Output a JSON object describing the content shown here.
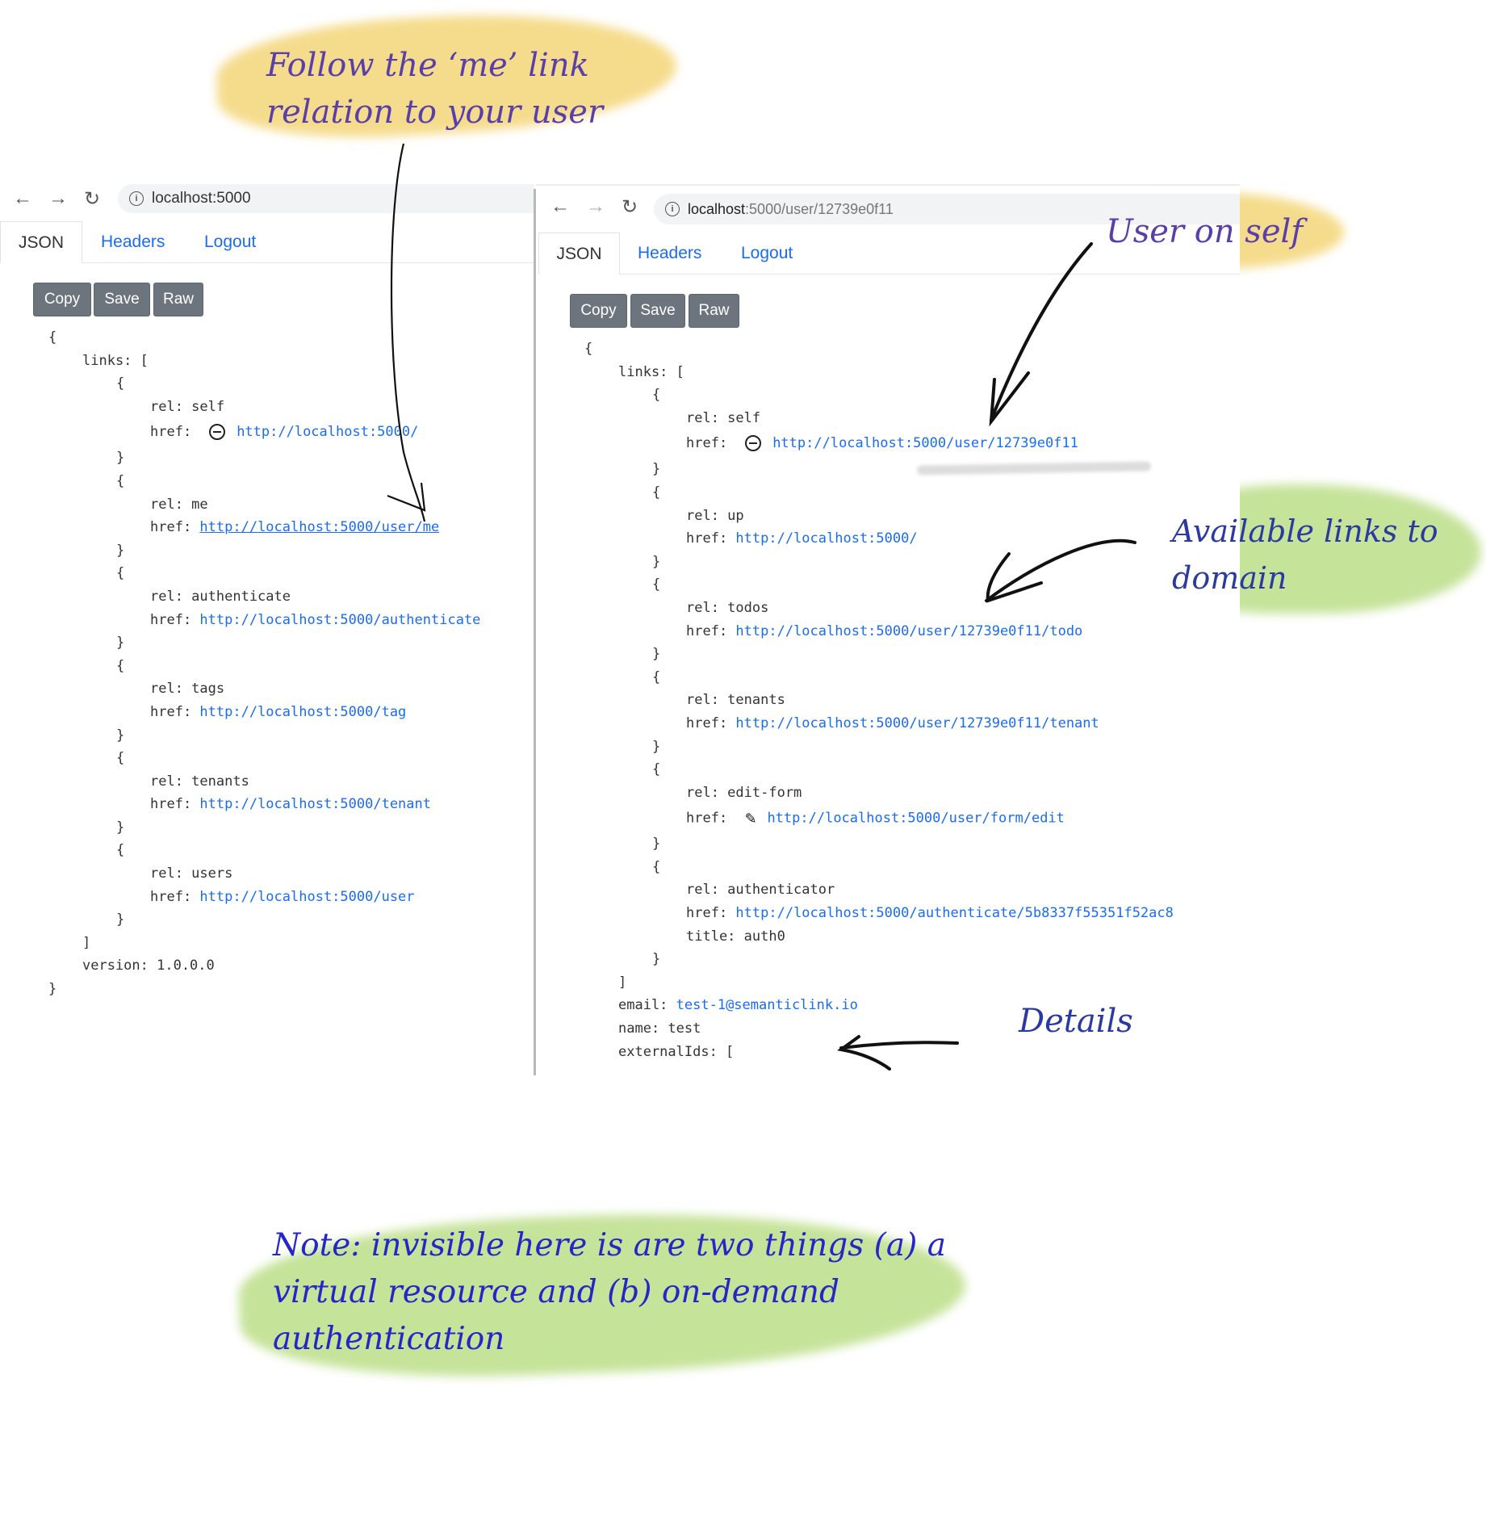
{
  "colors": {
    "link": "#1a6cf0",
    "button": "#6c757d",
    "annotation_purple": "#5b3fa8",
    "annotation_blue": "#2626c8",
    "highlight_yellow": "#f5dc8c",
    "highlight_green": "#c6e39a"
  },
  "annotations": {
    "follow_me": [
      "Follow the ‘me’ link",
      "relation to your user"
    ],
    "user_on_self": "User on self",
    "available_links": [
      "Available links to",
      "domain"
    ],
    "details": "Details",
    "note": [
      "Note: invisible here is are two things (a) a",
      "virtual resource and (b) on-demand",
      "authentication"
    ]
  },
  "left": {
    "url": "localhost:5000",
    "tabs": [
      "JSON",
      "Headers",
      "Logout"
    ],
    "buttons": [
      "Copy",
      "Save",
      "Raw"
    ],
    "code_lines": [
      {
        "indent": 0,
        "text": "{"
      },
      {
        "indent": 1,
        "text": "links: ["
      },
      {
        "indent": 2,
        "text": "{"
      },
      {
        "indent": 3,
        "text": "rel: self"
      },
      {
        "indent": 3,
        "text": "href:",
        "icon": "minus-circle-icon",
        "link": "http://localhost:5000/"
      },
      {
        "indent": 2,
        "text": "}"
      },
      {
        "indent": 2,
        "text": "{"
      },
      {
        "indent": 3,
        "text": "rel: me"
      },
      {
        "indent": 3,
        "text": "href: ",
        "link": "http://localhost:5000/user/me",
        "underline": true
      },
      {
        "indent": 2,
        "text": "}"
      },
      {
        "indent": 2,
        "text": "{"
      },
      {
        "indent": 3,
        "text": "rel: authenticate"
      },
      {
        "indent": 3,
        "text": "href: ",
        "link": "http://localhost:5000/authenticate"
      },
      {
        "indent": 2,
        "text": "}"
      },
      {
        "indent": 2,
        "text": "{"
      },
      {
        "indent": 3,
        "text": "rel: tags"
      },
      {
        "indent": 3,
        "text": "href: ",
        "link": "http://localhost:5000/tag"
      },
      {
        "indent": 2,
        "text": "}"
      },
      {
        "indent": 2,
        "text": "{"
      },
      {
        "indent": 3,
        "text": "rel: tenants"
      },
      {
        "indent": 3,
        "text": "href: ",
        "link": "http://localhost:5000/tenant"
      },
      {
        "indent": 2,
        "text": "}"
      },
      {
        "indent": 2,
        "text": "{"
      },
      {
        "indent": 3,
        "text": "rel: users"
      },
      {
        "indent": 3,
        "text": "href: ",
        "link": "http://localhost:5000/user"
      },
      {
        "indent": 2,
        "text": "}"
      },
      {
        "indent": 1,
        "text": "]"
      },
      {
        "indent": 1,
        "text": "version: 1.0.0.0"
      },
      {
        "indent": 0,
        "text": "}"
      }
    ]
  },
  "right": {
    "url_host": "localhost",
    "url_rest": ":5000/user/12739e0f11",
    "tabs": [
      "JSON",
      "Headers",
      "Logout"
    ],
    "buttons": [
      "Copy",
      "Save",
      "Raw"
    ],
    "code_lines": [
      {
        "indent": 0,
        "text": "{"
      },
      {
        "indent": 1,
        "text": "links: ["
      },
      {
        "indent": 2,
        "text": "{"
      },
      {
        "indent": 3,
        "text": "rel: self"
      },
      {
        "indent": 3,
        "text": "href:",
        "icon": "minus-circle-icon",
        "link": "http://localhost:5000/user/12739e0f11"
      },
      {
        "indent": 2,
        "text": "}"
      },
      {
        "indent": 2,
        "text": "{"
      },
      {
        "indent": 3,
        "text": "rel: up"
      },
      {
        "indent": 3,
        "text": "href: ",
        "link": "http://localhost:5000/"
      },
      {
        "indent": 2,
        "text": "}"
      },
      {
        "indent": 2,
        "text": "{"
      },
      {
        "indent": 3,
        "text": "rel: todos"
      },
      {
        "indent": 3,
        "text": "href: ",
        "link": "http://localhost:5000/user/12739e0f11/todo"
      },
      {
        "indent": 2,
        "text": "}"
      },
      {
        "indent": 2,
        "text": "{"
      },
      {
        "indent": 3,
        "text": "rel: tenants"
      },
      {
        "indent": 3,
        "text": "href: ",
        "link": "http://localhost:5000/user/12739e0f11/tenant"
      },
      {
        "indent": 2,
        "text": "}"
      },
      {
        "indent": 2,
        "text": "{"
      },
      {
        "indent": 3,
        "text": "rel: edit-form"
      },
      {
        "indent": 3,
        "text": "href:",
        "icon": "pencil-icon",
        "link": "http://localhost:5000/user/form/edit"
      },
      {
        "indent": 2,
        "text": "}"
      },
      {
        "indent": 2,
        "text": "{"
      },
      {
        "indent": 3,
        "text": "rel: authenticator"
      },
      {
        "indent": 3,
        "text": "href: ",
        "link": "http://localhost:5000/authenticate/5b8337f55351f52ac8"
      },
      {
        "indent": 3,
        "text": "title: auth0"
      },
      {
        "indent": 2,
        "text": "}"
      },
      {
        "indent": 1,
        "text": "]"
      },
      {
        "indent": 1,
        "text": "email: ",
        "link": "test-1@semanticlink.io"
      },
      {
        "indent": 1,
        "text": "name: test"
      },
      {
        "indent": 1,
        "text": "externalIds: ["
      }
    ]
  }
}
